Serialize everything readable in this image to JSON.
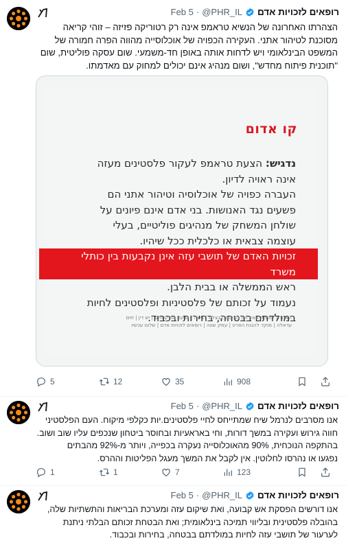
{
  "tweets": [
    {
      "author": "רופאים לזכויות אדם",
      "handle": "@PHR_IL",
      "date": "Feb 5",
      "lines": [
        "הצהרתו האחרונה של הנשיא טראמפ אינה רק רטוריקה פזיזה – זוהי קריאה",
        "מסוכנת לטיהור אתני. העקירה הכפויה של אוכלוסייה מהווה הפרה חמורה של",
        "המשפט הבינלאומי ויש לדחות אותה באופן חד-משמעי. שום עסקה פוליטית, שום",
        "\"תוכנית פיתוח מחדש\", ושום מנהיג אינם יכולים למחוק עם מאדמתו."
      ],
      "media": {
        "logo": "קו אדום",
        "label": "נדגיש:",
        "lines": [
          "הצעת טראמפ לעקור פלסטינים מעזה",
          "אינה ראויה לדיון.",
          "העברה כפויה של אוכלוסיה וטיהור אתני הם",
          "פשעים נגד האנושות. בני אדם אינם פיונים על",
          "שולחן המשחק של מנהיגים פוליטיים, בעלי",
          "עוצמה צבאית או כלכלית ככל שיהיו."
        ],
        "highlight": "זכויות האדם של תושבי עזה אינן נקבעות בין כותלי משרד",
        "after_lines": [
          "ראש הממשלה או בבית הלבן.",
          "נעמוד על זכותם של פלסטיניות ופלסטינים לחיות",
          "במולדתם בבטחה, בחירות ובכבוד."
        ],
        "footer_lines": [
          "האגודה לזכויות האזרח | במקום | בצלם | גישה | הוועד נגד עינויים | יש דין | זזים",
          "עדאלה | מוקד להגנת הפרט | עמק שווה | רופאים לזכויות אדם | שלום עכשיו"
        ]
      },
      "stats": {
        "replies": "5",
        "retweets": "12",
        "likes": "35",
        "views": "908"
      }
    },
    {
      "author": "רופאים לזכויות אדם",
      "handle": "@PHR_IL",
      "date": "Feb 5",
      "lines": [
        "אנו מסרבים לנרמל שיח שמתייחס לחיי פלסטינים.יות כקלפי מיקוח. העם הפלסטיני",
        "חווה גירוש ועקירה במשך דורות, וחי באראעיות ובחוסר ביטחון שנכפים עליו שוב ושוב.",
        "בהתקפה הנוכחית, 90% מהאוכלוסייה נעקרה בכפייה, ויותר מ-92% מהבתים",
        "נפגעו או נהרסו לחלוטין. אין לקבל את המשך מעגל הפליטות וההרס."
      ],
      "stats": {
        "replies": "1",
        "retweets": "1",
        "likes": "7",
        "views": "123"
      }
    },
    {
      "author": "רופאים לזכויות אדם",
      "handle": "@PHR_IL",
      "date": "Feb 5",
      "lines": [
        "אנו דורשים הפסקת אש קבועה, ואת שיקום עזה ומערכת הבריאות והתשתיות שלה,",
        "בהובלה פלסטינית ובליווי תמיכה בינלאומית; ואת הבטחת זכותם הבלתי ניתנת",
        "לערעור של תושבי עזה לחיות במולדתם בבטחה, בחירות ובכבוד."
      ]
    }
  ],
  "colors": {
    "accent": "#1d9bf0",
    "muted": "#536471",
    "logo_red": "#d71920",
    "highlight_red": "#e3161d",
    "avatar_orange": "#f08a1c"
  },
  "icons": [
    "avatar-logo",
    "verified-badge-icon",
    "grok-icon",
    "reply-icon",
    "retweet-icon",
    "like-icon",
    "views-icon",
    "bookmark-icon",
    "share-icon"
  ]
}
